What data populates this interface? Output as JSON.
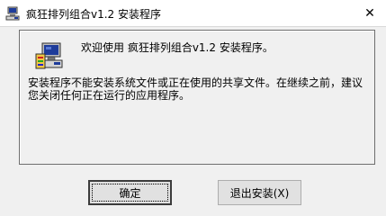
{
  "window": {
    "title": "疯狂排列组合v1.2 安装程序",
    "icon": "setup-computer-icon",
    "close_label": "✕"
  },
  "panel": {
    "welcome": "欢迎使用 疯狂排列组合v1.2 安装程序。",
    "message": "安装程序不能安装系统文件或正在使用的共享文件。在继续之前，建议您关闭任何正在运行的应用程序。"
  },
  "buttons": {
    "ok": "确定",
    "exit": "退出安装(X)"
  }
}
